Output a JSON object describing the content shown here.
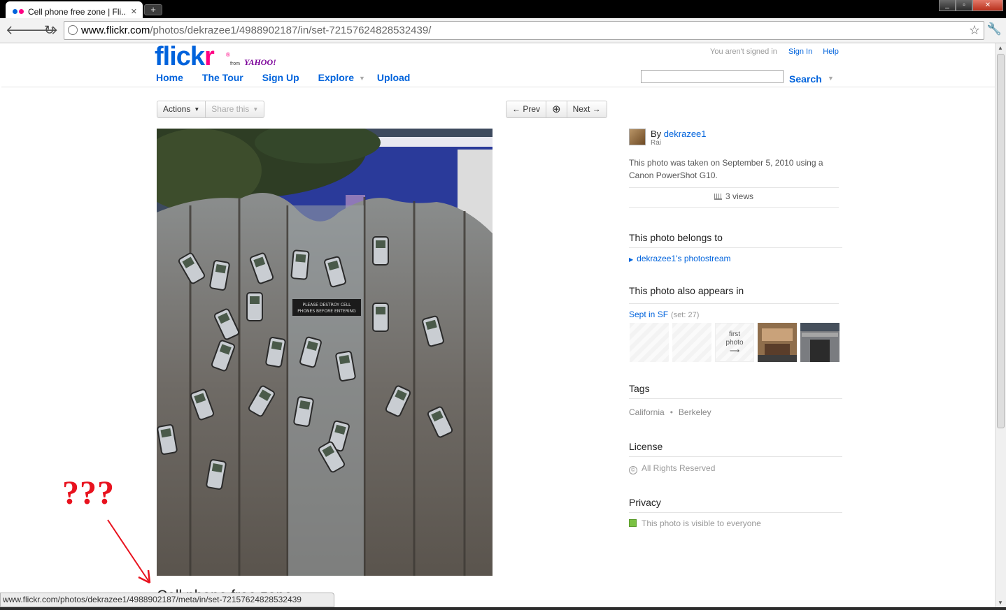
{
  "browser": {
    "tab_title": "Cell phone free zone | Fli...",
    "tab_close": "✕",
    "new_tab": "+",
    "url_host": "www.flickr.com",
    "url_path": "/photos/dekrazee1/4988902187/in/set-72157624828532439/",
    "status_url": "www.flickr.com/photos/dekrazee1/4988902187/meta/in/set-72157624828532439",
    "back_glyph": "🡐",
    "forward_glyph": "🡒",
    "reload_glyph": "↻",
    "star_glyph": "☆",
    "wrench_glyph": "🔧",
    "min_glyph": "_",
    "max_glyph": "▫",
    "close_glyph": "✕"
  },
  "header": {
    "logo_fl": "flick",
    "logo_kr": "r",
    "logo_reg": "®",
    "logo_from": "from",
    "logo_yahoo": "YAHOO!",
    "nav": [
      "Home",
      "The Tour",
      "Sign Up",
      "Explore",
      "Upload"
    ],
    "not_signed_in": "You aren't signed in",
    "sign_in": "Sign In",
    "help": "Help",
    "search_label": "Search",
    "search_value": ""
  },
  "actions": {
    "actions_label": "Actions",
    "share_label": "Share this",
    "prev_label": "Prev",
    "next_label": "Next",
    "zoom_glyph": "⊕"
  },
  "photo": {
    "title_partial": "Cell phone free zone",
    "sign_line1": "PLEASE DESTROY CELL",
    "sign_line2": "PHONES BEFORE ENTERING"
  },
  "sidebar": {
    "by_prefix": "By",
    "owner": "dekrazee1",
    "real_name": "Rai",
    "taken_text": "This photo was taken on September 5, 2010 using a Canon PowerShot G10.",
    "views": "3 views",
    "belongs_heading": "This photo belongs to",
    "photostream_link": "dekrazee1's photostream",
    "appears_heading": "This photo also appears in",
    "set_name": "Sept in SF",
    "set_count": "(set: 27)",
    "first_photo_line1": "first",
    "first_photo_line2": "photo",
    "first_photo_arrow": "⟶",
    "tags_heading": "Tags",
    "tags": [
      "California",
      "Berkeley"
    ],
    "tag_separator": "•",
    "license_heading": "License",
    "license_text": "All Rights Reserved",
    "license_icon": "©",
    "privacy_heading": "Privacy",
    "privacy_text": "This photo is visible to everyone"
  },
  "annotation": {
    "question_marks": "???"
  },
  "colors": {
    "flickr_blue": "#0063dc",
    "flickr_pink": "#ff0084",
    "annotation_red": "#e8121e",
    "privacy_green": "#7ac142"
  }
}
